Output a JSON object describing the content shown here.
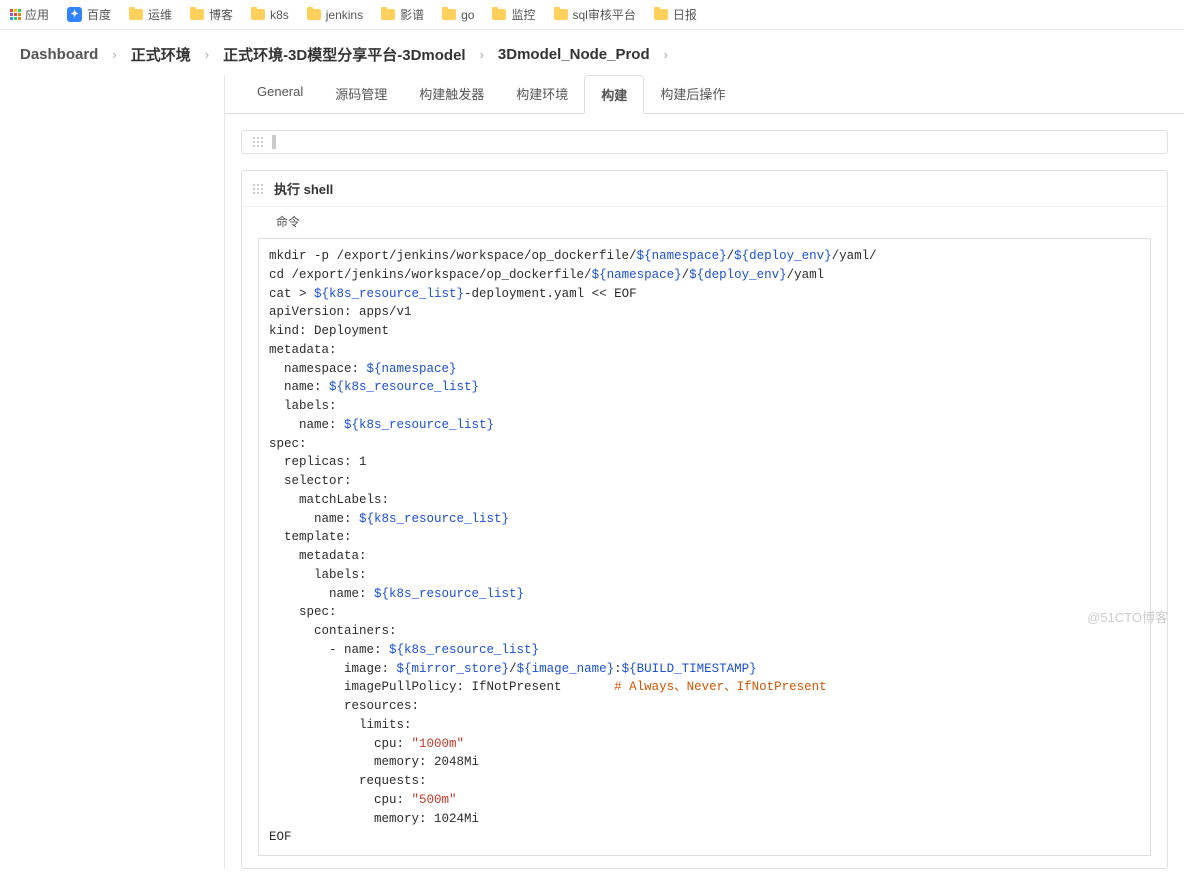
{
  "bookmarks": {
    "appsLabel": "应用",
    "items": [
      "百度",
      "运维",
      "博客",
      "k8s",
      "jenkins",
      "影谱",
      "go",
      "监控",
      "sql审核平台",
      "日报"
    ]
  },
  "breadcrumb": [
    "Dashboard",
    "正式环境",
    "正式环境-3D模型分享平台-3Dmodel",
    "3Dmodel_Node_Prod"
  ],
  "tabs": [
    "General",
    "源码管理",
    "构建触发器",
    "构建环境",
    "构建",
    "构建后操作"
  ],
  "activeTab": "构建",
  "shell": {
    "title": "执行 shell",
    "commandLabel": "命令"
  },
  "code": {
    "segments": [
      {
        "t": "mkdir -p /export/jenkins/workspace/op_dockerfile/",
        "c": "black"
      },
      {
        "t": "${namespace}",
        "c": "blue"
      },
      {
        "t": "/",
        "c": "black"
      },
      {
        "t": "${deploy_env}",
        "c": "blue"
      },
      {
        "t": "/yaml/",
        "c": "black"
      },
      {
        "t": "\n",
        "c": "nl"
      },
      {
        "t": "cd /export/jenkins/workspace/op_dockerfile/",
        "c": "black"
      },
      {
        "t": "${namespace}",
        "c": "blue"
      },
      {
        "t": "/",
        "c": "black"
      },
      {
        "t": "${deploy_env}",
        "c": "blue"
      },
      {
        "t": "/yaml",
        "c": "black"
      },
      {
        "t": "\n",
        "c": "nl"
      },
      {
        "t": "cat > ",
        "c": "black"
      },
      {
        "t": "${k8s_resource_list}",
        "c": "blue"
      },
      {
        "t": "-deployment.yaml << EOF",
        "c": "black"
      },
      {
        "t": "\n",
        "c": "nl"
      },
      {
        "t": "apiVersion: apps/v1",
        "c": "black"
      },
      {
        "t": "\n",
        "c": "nl"
      },
      {
        "t": "kind: Deployment",
        "c": "black"
      },
      {
        "t": "\n",
        "c": "nl"
      },
      {
        "t": "metadata:",
        "c": "black"
      },
      {
        "t": "\n",
        "c": "nl"
      },
      {
        "t": "  namespace: ",
        "c": "black"
      },
      {
        "t": "${namespace}",
        "c": "blue"
      },
      {
        "t": "\n",
        "c": "nl"
      },
      {
        "t": "  name: ",
        "c": "black"
      },
      {
        "t": "${k8s_resource_list}",
        "c": "blue"
      },
      {
        "t": "\n",
        "c": "nl"
      },
      {
        "t": "  labels:",
        "c": "black"
      },
      {
        "t": "\n",
        "c": "nl"
      },
      {
        "t": "    name: ",
        "c": "black"
      },
      {
        "t": "${k8s_resource_list}",
        "c": "blue"
      },
      {
        "t": "\n",
        "c": "nl"
      },
      {
        "t": "spec:",
        "c": "black"
      },
      {
        "t": "\n",
        "c": "nl"
      },
      {
        "t": "  replicas: 1",
        "c": "black"
      },
      {
        "t": "\n",
        "c": "nl"
      },
      {
        "t": "  selector:",
        "c": "black"
      },
      {
        "t": "\n",
        "c": "nl"
      },
      {
        "t": "    matchLabels:",
        "c": "black"
      },
      {
        "t": "\n",
        "c": "nl"
      },
      {
        "t": "      name: ",
        "c": "black"
      },
      {
        "t": "${k8s_resource_list}",
        "c": "blue"
      },
      {
        "t": "\n",
        "c": "nl"
      },
      {
        "t": "  template:",
        "c": "black"
      },
      {
        "t": "\n",
        "c": "nl"
      },
      {
        "t": "    metadata:",
        "c": "black"
      },
      {
        "t": "\n",
        "c": "nl"
      },
      {
        "t": "      labels:",
        "c": "black"
      },
      {
        "t": "\n",
        "c": "nl"
      },
      {
        "t": "        name: ",
        "c": "black"
      },
      {
        "t": "${k8s_resource_list}",
        "c": "blue"
      },
      {
        "t": "\n",
        "c": "nl"
      },
      {
        "t": "    spec:",
        "c": "black"
      },
      {
        "t": "\n",
        "c": "nl"
      },
      {
        "t": "      containers:",
        "c": "black"
      },
      {
        "t": "\n",
        "c": "nl"
      },
      {
        "t": "        - name: ",
        "c": "black"
      },
      {
        "t": "${k8s_resource_list}",
        "c": "blue"
      },
      {
        "t": "\n",
        "c": "nl"
      },
      {
        "t": "          image: ",
        "c": "black"
      },
      {
        "t": "${mirror_store}",
        "c": "blue"
      },
      {
        "t": "/",
        "c": "black"
      },
      {
        "t": "${image_name}",
        "c": "blue"
      },
      {
        "t": ":",
        "c": "black"
      },
      {
        "t": "${BUILD_TIMESTAMP}",
        "c": "blue"
      },
      {
        "t": "\n",
        "c": "nl"
      },
      {
        "t": "          imagePullPolicy: IfNotPresent       ",
        "c": "black"
      },
      {
        "t": "# Always、Never、IfNotPresent",
        "c": "orange"
      },
      {
        "t": "\n",
        "c": "nl"
      },
      {
        "t": "          resources:",
        "c": "black"
      },
      {
        "t": "\n",
        "c": "nl"
      },
      {
        "t": "            limits:",
        "c": "black"
      },
      {
        "t": "\n",
        "c": "nl"
      },
      {
        "t": "              cpu: ",
        "c": "black"
      },
      {
        "t": "\"1000m\"",
        "c": "red"
      },
      {
        "t": "\n",
        "c": "nl"
      },
      {
        "t": "              memory: 2048Mi",
        "c": "black"
      },
      {
        "t": "\n",
        "c": "nl"
      },
      {
        "t": "            requests:",
        "c": "black"
      },
      {
        "t": "\n",
        "c": "nl"
      },
      {
        "t": "              cpu: ",
        "c": "black"
      },
      {
        "t": "\"500m\"",
        "c": "red"
      },
      {
        "t": "\n",
        "c": "nl"
      },
      {
        "t": "              memory: 1024Mi",
        "c": "black"
      },
      {
        "t": "\n",
        "c": "nl"
      },
      {
        "t": "EOF",
        "c": "black"
      }
    ]
  },
  "watermark": "@51CTO博客"
}
